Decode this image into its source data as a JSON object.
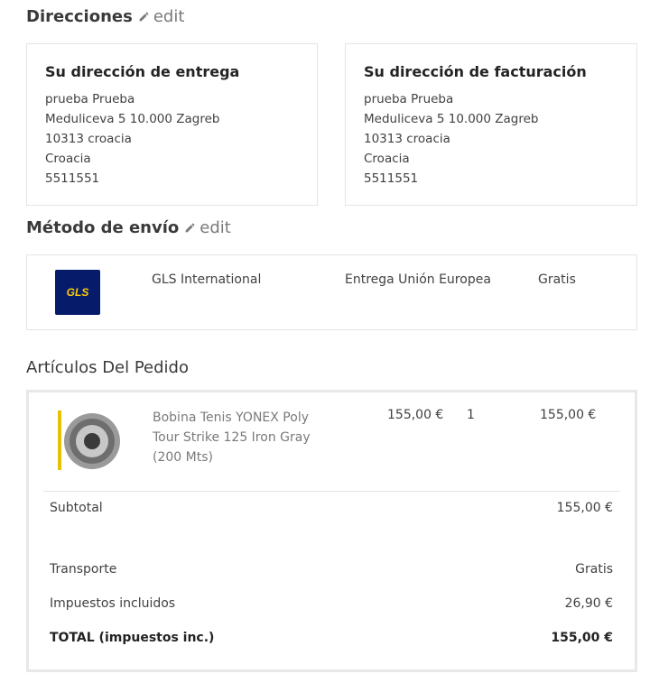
{
  "addresses": {
    "title": "Direcciones",
    "edit_label": "edit",
    "delivery": {
      "title": "Su dirección de entrega",
      "lines": [
        "prueba Prueba",
        "Meduliceva 5 10.000 Zagreb",
        "10313 croacia",
        "Croacia",
        "5511551"
      ]
    },
    "billing": {
      "title": "Su dirección de facturación",
      "lines": [
        "prueba Prueba",
        "Meduliceva 5 10.000 Zagreb",
        "10313 croacia",
        "Croacia",
        "5511551"
      ]
    }
  },
  "shipping": {
    "title": "Método de envío",
    "edit_label": "edit",
    "carrier_logo": "GLS",
    "carrier": "GLS International",
    "delay": "Entrega Unión Europea",
    "price": "Gratis"
  },
  "order": {
    "title": "Artículos Del Pedido",
    "items": [
      {
        "name": "Bobina Tenis YONEX Poly Tour Strike 125 Iron Gray (200 Mts)",
        "unit_price": "155,00 €",
        "quantity": "1",
        "total": "155,00 €"
      }
    ],
    "summary": {
      "subtotal_label": "Subtotal",
      "subtotal_value": "155,00 €",
      "shipping_label": "Transporte",
      "shipping_value": "Gratis",
      "tax_label": "Impuestos incluidos",
      "tax_value": "26,90 €",
      "total_label": "TOTAL (impuestos inc.)",
      "total_value": "155,00 €"
    }
  },
  "colors": {
    "gls_bg": "#061c6b",
    "gls_text": "#ffcc00",
    "border": "#e5e5e5"
  }
}
